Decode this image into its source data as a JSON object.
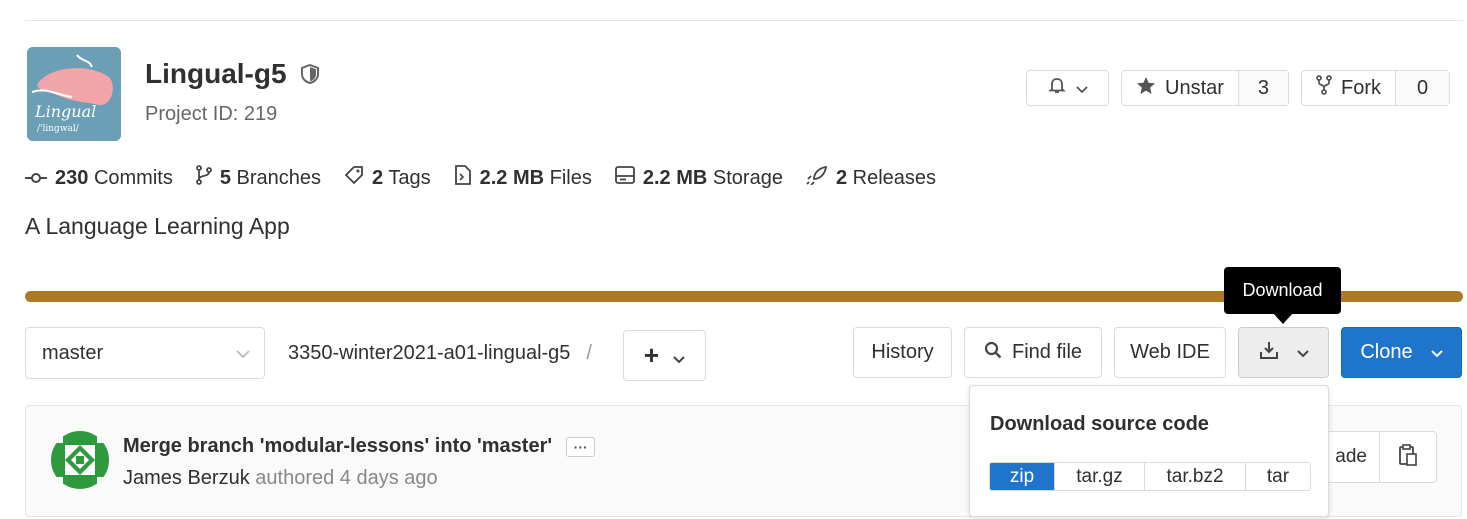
{
  "project": {
    "name": "Lingual-g5",
    "id_label": "Project ID: 219",
    "avatar_text": "Lingual",
    "avatar_subtext": "/'lingwal/",
    "description": "A Language Learning App"
  },
  "actions": {
    "unstar_label": "Unstar",
    "star_count": "3",
    "fork_label": "Fork",
    "fork_count": "0"
  },
  "stats": [
    {
      "value": "230",
      "label": "Commits",
      "icon": "commit-icon"
    },
    {
      "value": "5",
      "label": "Branches",
      "icon": "branch-icon"
    },
    {
      "value": "2",
      "label": "Tags",
      "icon": "tag-icon"
    },
    {
      "value": "2.2 MB",
      "label": "Files",
      "icon": "file-icon"
    },
    {
      "value": "2.2 MB",
      "label": "Storage",
      "icon": "storage-icon"
    },
    {
      "value": "2",
      "label": "Releases",
      "icon": "rocket-icon"
    }
  ],
  "language_bar_color": "#b07a22",
  "toolbar": {
    "branch": "master",
    "path": "3350-winter2021-a01-lingual-g5",
    "path_separator": "/",
    "add_label": "+",
    "history": "History",
    "find_file": "Find file",
    "web_ide": "Web IDE",
    "clone": "Clone",
    "download_tooltip": "Download"
  },
  "commit": {
    "title": "Merge branch 'modular-lessons' into 'master'",
    "ellipsis": "···",
    "author": "James Berzuk",
    "meta": " authored 4 days ago",
    "right_label": "ade"
  },
  "download_menu": {
    "title": "Download source code",
    "formats": [
      "zip",
      "tar.gz",
      "tar.bz2",
      "tar"
    ],
    "selected": "zip"
  },
  "colors": {
    "primary": "#1f75cb",
    "tooltip_bg": "#000000"
  }
}
